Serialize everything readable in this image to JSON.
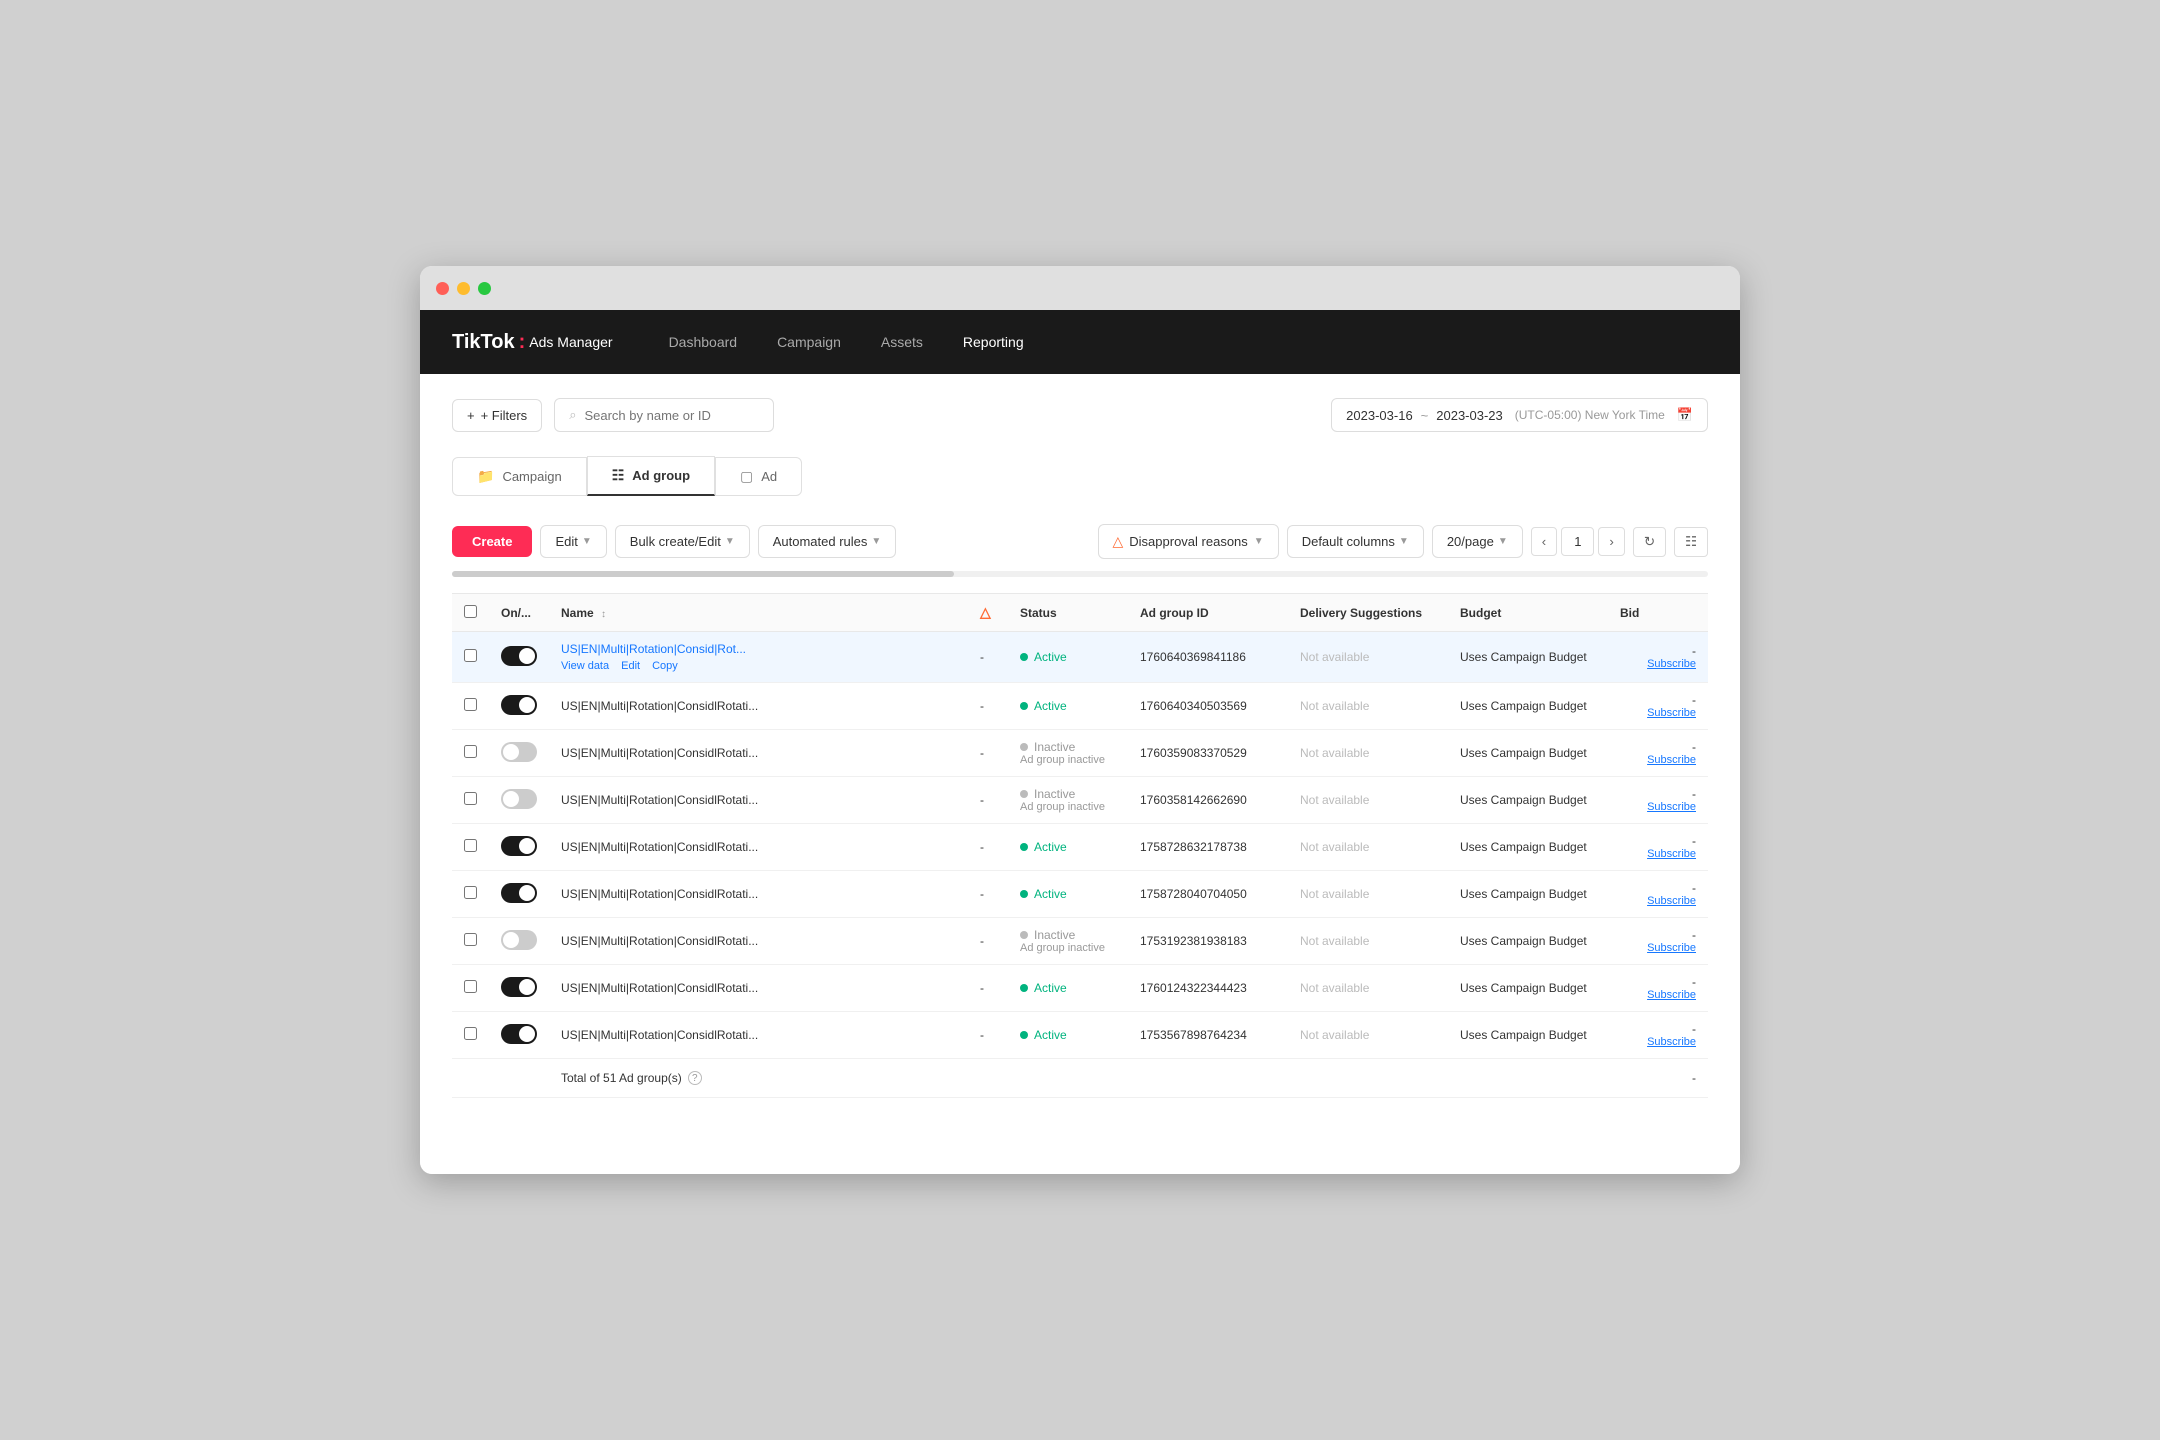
{
  "window": {
    "title": "TikTok Ads Manager"
  },
  "navbar": {
    "logo_tiktok": "TikTok",
    "logo_separator": ":",
    "logo_ads": "Ads Manager",
    "nav_items": [
      {
        "label": "Dashboard",
        "active": false
      },
      {
        "label": "Campaign",
        "active": false
      },
      {
        "label": "Assets",
        "active": false
      },
      {
        "label": "Reporting",
        "active": true
      }
    ]
  },
  "filters": {
    "filters_button": "+ Filters",
    "search_placeholder": "Search by name or ID",
    "date_start": "2023-03-16",
    "date_end": "2023-03-23",
    "date_separator": "~",
    "timezone": "(UTC-05:00) New York Time"
  },
  "tabs": [
    {
      "label": "Campaign",
      "active": false,
      "icon": "folder"
    },
    {
      "label": "Ad group",
      "active": true,
      "icon": "grid"
    },
    {
      "label": "Ad",
      "active": false,
      "icon": "image"
    }
  ],
  "toolbar": {
    "create": "Create",
    "edit": "Edit",
    "bulk_create_edit": "Bulk create/Edit",
    "automated_rules": "Automated rules",
    "disapproval_reasons": "Disapproval reasons",
    "default_columns": "Default columns",
    "page_size": "20/page",
    "page_number": "1"
  },
  "table": {
    "columns": [
      {
        "key": "on_off",
        "label": "On/..."
      },
      {
        "key": "name",
        "label": "Name"
      },
      {
        "key": "warn",
        "label": ""
      },
      {
        "key": "status",
        "label": "Status"
      },
      {
        "key": "id",
        "label": "Ad group ID"
      },
      {
        "key": "delivery",
        "label": "Delivery Suggestions"
      },
      {
        "key": "budget",
        "label": "Budget"
      },
      {
        "key": "bid",
        "label": "Bid"
      }
    ],
    "rows": [
      {
        "id": "r1",
        "toggle": "on",
        "name": "US|EN|Multi|Rotation|Consid|Rot...",
        "name_full": "US|EN|Multi|Rotation|ConsidlRot...",
        "is_link": true,
        "warn": false,
        "status": "Active",
        "status_type": "active",
        "status_sub": "",
        "ad_group_id": "1760640369841186",
        "delivery": "Not available",
        "budget": "Uses Campaign Budget",
        "bid": "-",
        "subscribe": "Subscribe",
        "highlighted": true,
        "actions": [
          "View data",
          "Edit",
          "Copy"
        ]
      },
      {
        "id": "r2",
        "toggle": "on",
        "name": "US|EN|Multi|Rotation|ConsidlRotati...",
        "is_link": false,
        "warn": false,
        "status": "Active",
        "status_type": "active",
        "status_sub": "",
        "ad_group_id": "1760640340503569",
        "delivery": "Not available",
        "budget": "Uses Campaign Budget",
        "bid": "-",
        "subscribe": "Subscribe",
        "highlighted": false,
        "actions": []
      },
      {
        "id": "r3",
        "toggle": "off",
        "name": "US|EN|Multi|Rotation|ConsidlRotati...",
        "is_link": false,
        "warn": false,
        "status": "Inactive",
        "status_type": "inactive",
        "status_sub": "Ad group inactive",
        "ad_group_id": "1760359083370529",
        "delivery": "Not available",
        "budget": "Uses Campaign Budget",
        "bid": "-",
        "subscribe": "Subscribe",
        "highlighted": false,
        "actions": []
      },
      {
        "id": "r4",
        "toggle": "off",
        "name": "US|EN|Multi|Rotation|ConsidlRotati...",
        "is_link": false,
        "warn": false,
        "status": "Inactive",
        "status_type": "inactive",
        "status_sub": "Ad group inactive",
        "ad_group_id": "1760358142662690",
        "delivery": "Not available",
        "budget": "Uses Campaign Budget",
        "bid": "-",
        "subscribe": "Subscribe",
        "highlighted": false,
        "actions": []
      },
      {
        "id": "r5",
        "toggle": "on",
        "name": "US|EN|Multi|Rotation|ConsidlRotati...",
        "is_link": false,
        "warn": false,
        "status": "Active",
        "status_type": "active",
        "status_sub": "",
        "ad_group_id": "1758728632178738",
        "delivery": "Not available",
        "budget": "Uses Campaign Budget",
        "bid": "-",
        "subscribe": "Subscribe",
        "highlighted": false,
        "actions": []
      },
      {
        "id": "r6",
        "toggle": "on",
        "name": "US|EN|Multi|Rotation|ConsidlRotati...",
        "is_link": false,
        "warn": false,
        "status": "Active",
        "status_type": "active",
        "status_sub": "",
        "ad_group_id": "1758728040704050",
        "delivery": "Not available",
        "budget": "Uses Campaign Budget",
        "bid": "-",
        "subscribe": "Subscribe",
        "highlighted": false,
        "actions": []
      },
      {
        "id": "r7",
        "toggle": "off",
        "name": "US|EN|Multi|Rotation|ConsidlRotati...",
        "is_link": false,
        "warn": false,
        "status": "Inactive",
        "status_type": "inactive",
        "status_sub": "Ad group inactive",
        "ad_group_id": "1753192381938183",
        "delivery": "Not available",
        "budget": "Uses Campaign Budget",
        "bid": "-",
        "subscribe": "Subscribe",
        "highlighted": false,
        "actions": []
      },
      {
        "id": "r8",
        "toggle": "on",
        "name": "US|EN|Multi|Rotation|ConsidlRotati...",
        "is_link": false,
        "warn": false,
        "status": "Active",
        "status_type": "active",
        "status_sub": "",
        "ad_group_id": "1760124322344423",
        "delivery": "Not available",
        "budget": "Uses Campaign Budget",
        "bid": "-",
        "subscribe": "Subscribe",
        "highlighted": false,
        "actions": []
      },
      {
        "id": "r9",
        "toggle": "on",
        "name": "US|EN|Multi|Rotation|ConsidlRotati...",
        "is_link": false,
        "warn": false,
        "status": "Active",
        "status_type": "active",
        "status_sub": "",
        "ad_group_id": "1753567898764234",
        "delivery": "Not available",
        "budget": "Uses Campaign Budget",
        "bid": "-",
        "subscribe": "Subscribe",
        "highlighted": false,
        "actions": []
      }
    ],
    "footer": {
      "total_label": "Total of 51 Ad group(s)",
      "total_bid": "-"
    }
  }
}
